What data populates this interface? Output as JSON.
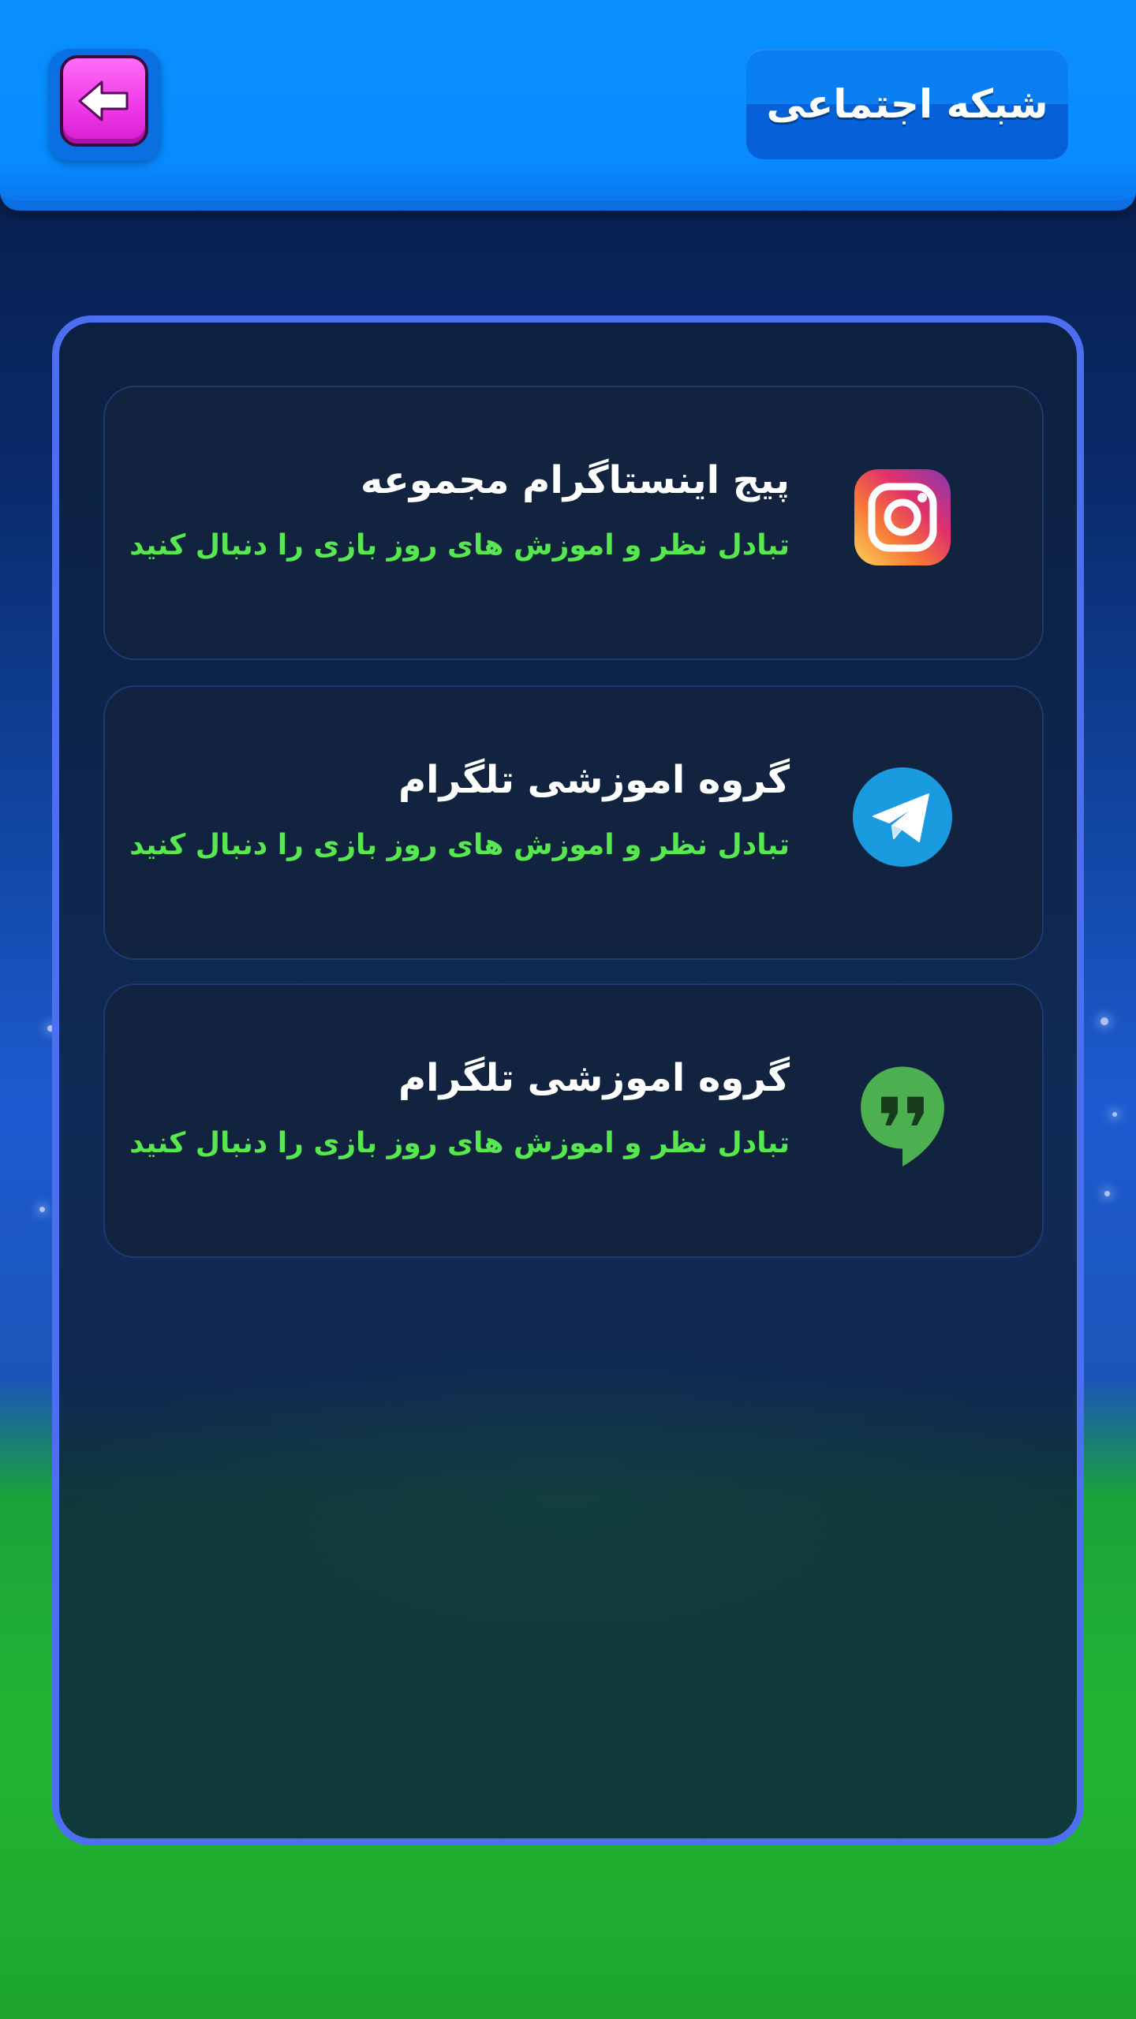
{
  "header": {
    "title": "شبکه اجتماعی",
    "back_icon": "arrow-left-icon",
    "back_button_color": "#f03be8",
    "background_color": "#078bff"
  },
  "social_links": [
    {
      "title": "پیج اینستاگرام مجموعه",
      "subtitle": "تبادل نظر و اموزش های روز بازی را دنبال کنید",
      "icon": "instagram-icon"
    },
    {
      "title": "گروه اموزشی تلگرام",
      "subtitle": "تبادل نظر و اموزش های روز بازی را دنبال کنید",
      "icon": "telegram-icon"
    },
    {
      "title": "گروه اموزشی تلگرام",
      "subtitle": "تبادل نظر و اموزش های روز بازی را دنبال کنید",
      "icon": "hangouts-icon"
    }
  ],
  "colors": {
    "panel_border": "#4c6ff2",
    "subtitle_green": "#56e84e",
    "telegram_blue": "#1a9bdf",
    "hangouts_green": "#4caf50"
  }
}
